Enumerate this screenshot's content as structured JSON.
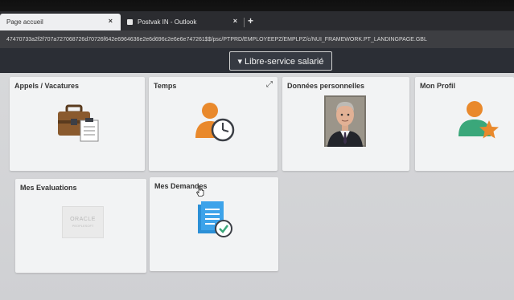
{
  "browser": {
    "tabs": [
      {
        "title": "Page accueil",
        "close": "×"
      },
      {
        "title": "Postvak IN - Outlook",
        "close": "×"
      }
    ],
    "new_tab": "+",
    "url": "47470733a2f2f707a727068726d70726f642e6964636e2e6d696c2e6e6e747261$$/psc/PTPRD/EMPLOYEEPZ/EMPLPZ/c/NUI_FRAMEWORK.PT_LANDINGPAGE.GBL"
  },
  "header": {
    "title": "▾ Libre-service salarié"
  },
  "tiles": [
    {
      "title": "Appels / Vacatures",
      "icon": "briefcase-icon"
    },
    {
      "title": "Temps",
      "icon": "person-clock-icon",
      "expand": "⤢"
    },
    {
      "title": "Données personnelles",
      "icon": "employee-photo"
    },
    {
      "title": "Mon Profil",
      "icon": "person-star-icon"
    },
    {
      "title": "Mes Evaluations",
      "icon": "oracle-peoplesoft-logo",
      "logo_line1": "ORACLE",
      "logo_line2": "PEOPLESOFT"
    },
    {
      "title": "Mes Demandes",
      "icon": "document-check-icon"
    }
  ],
  "colors": {
    "header_bg": "#2b2e35",
    "tile_bg": "#f2f3f4",
    "accent_orange": "#e9892c",
    "accent_green": "#3aa77a",
    "accent_blue": "#2b8fd6"
  }
}
